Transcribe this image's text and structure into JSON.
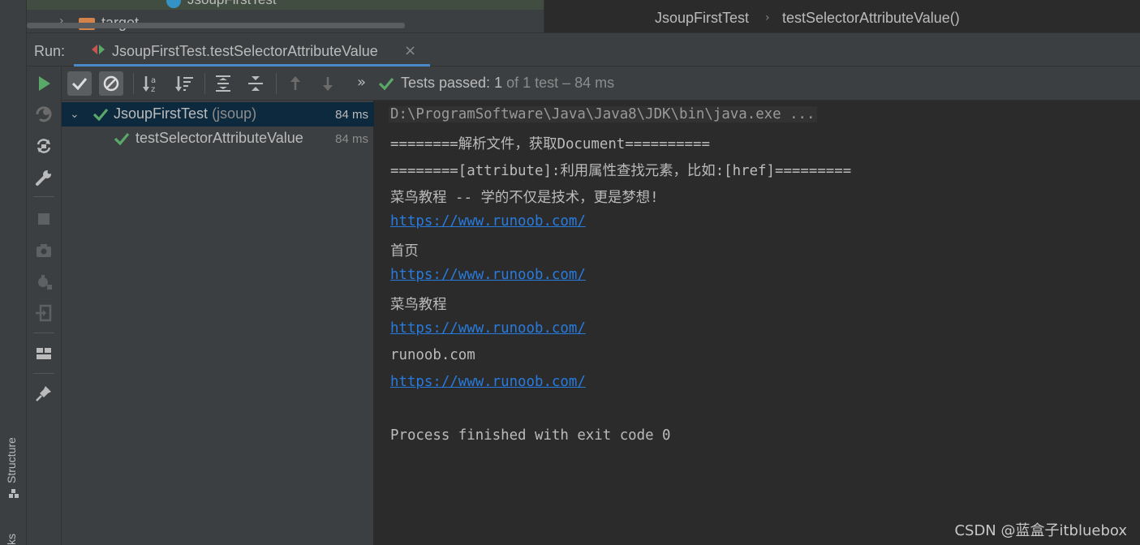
{
  "left_strip": {
    "structure_label": "Structure",
    "bookmarks_label": "ks"
  },
  "project_tree": {
    "file_label": "JsoupFirstTest",
    "folder_label": "target"
  },
  "breadcrumb": {
    "items": [
      "JsoupFirstTest",
      "testSelectorAttributeValue()"
    ]
  },
  "run_panel": {
    "label": "Run:",
    "tab_label": "JsoupFirstTest.testSelectorAttributeValue",
    "tab_close": "×"
  },
  "test_toolbar": {
    "more": "»",
    "status_prefix": "Tests passed:",
    "status_count": "1",
    "status_rest": "of 1 test – 84 ms"
  },
  "test_tree": {
    "rows": [
      {
        "name": "JsoupFirstTest",
        "pkg": "(jsoup)",
        "duration": "84 ms"
      },
      {
        "name": "testSelectorAttributeValue",
        "duration": "84 ms"
      }
    ]
  },
  "console": {
    "lines": [
      "D:\\ProgramSoftware\\Java\\Java8\\JDK\\bin\\java.exe ...",
      "========解析文件，获取Document==========",
      "========[attribute]:利用属性查找元素，比如:[href]=========",
      "菜鸟教程 -- 学的不仅是技术，更是梦想!",
      "https://www.runoob.com/",
      "首页",
      "https://www.runoob.com/",
      "菜鸟教程",
      "https://www.runoob.com/",
      "runoob.com",
      "https://www.runoob.com/",
      "",
      "Process finished with exit code 0"
    ]
  },
  "watermark": "CSDN @蓝盒子itbluebox",
  "colors": {
    "accent": "#4a88c7",
    "pass_green": "#59a869",
    "link": "#287bde",
    "selection": "#0d293e"
  }
}
